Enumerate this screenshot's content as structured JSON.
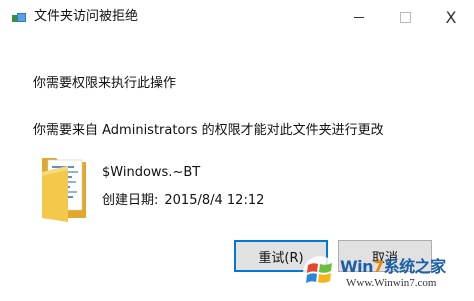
{
  "window": {
    "title": "文件夹访问被拒绝",
    "controls": {
      "minimize_icon": "minimize-icon",
      "maximize_icon": "maximize-icon",
      "close_glyph": "X"
    }
  },
  "message": {
    "heading": "你需要权限来执行此操作",
    "detail": "你需要来自 Administrators 的权限才能对此文件夹进行更改"
  },
  "folder": {
    "icon": "folder-icon",
    "name": "$Windows.~BT",
    "date_label": "创建日期:",
    "date_value": "2015/8/4 12:12"
  },
  "buttons": {
    "retry_label": "重试(R)",
    "cancel_label": "取消"
  },
  "watermark": {
    "title_prefix": "Win",
    "title_accent": "7",
    "title_suffix": "系统之家",
    "url": "Www.Winwin7.com"
  },
  "colors": {
    "focus_border": "#0078d7",
    "button_bg": "#e1e1e1",
    "folder_yellow": "#f3c84b",
    "watermark_blue": "#1a5fa8",
    "watermark_orange": "#e58a0a"
  }
}
